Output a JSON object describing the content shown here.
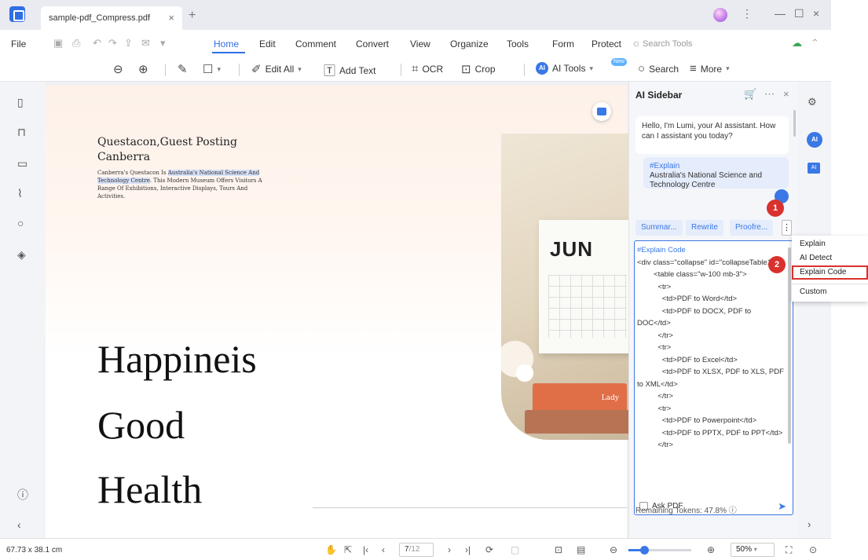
{
  "tab": {
    "title": "sample-pdf_Compress.pdf",
    "close": "×",
    "add": "+"
  },
  "window": {
    "menu_dots": "⋮",
    "minimize": "—",
    "maximize": "☐",
    "close": "×"
  },
  "menu": {
    "file": "File",
    "items": [
      "Home",
      "Edit",
      "Comment",
      "Convert",
      "View",
      "Organize",
      "Tools",
      "Form",
      "Protect"
    ],
    "active": "Home",
    "search_tools": "Search Tools"
  },
  "toolbar": {
    "edit_all": "Edit All",
    "add_text": "Add Text",
    "ocr": "OCR",
    "crop": "Crop",
    "ai_tools": "AI Tools",
    "ai_badge": "AI",
    "new_badge": "New",
    "search": "Search",
    "more": "More"
  },
  "document": {
    "heading": "Questacon,Guest Posting",
    "heading2": "Canberra",
    "body_pre": "Canberra's Questacon Is ",
    "body_hl": "Australia's National Science And Technology Centre",
    "body_post": ". This Modern Museum Offers Visitors A Range Of Exhibitions, Interactive Displays, Tours And Activities.",
    "big_words": [
      "Happineis",
      "Good",
      "Health"
    ],
    "calendar_month": "JUN",
    "book_label": "Lady"
  },
  "sidebar": {
    "title": "AI Sidebar",
    "greeting": "Hello, I'm Lumi, your AI assistant. How can I assistant you today?",
    "user_tag": "#Explain",
    "user_text": "Australia's National Science and Technology Centre",
    "chips": [
      "Summar...",
      "Rewrite",
      "Proofre..."
    ],
    "more": "⋮",
    "code_tag": "#Explain Code",
    "code_body": "<div class=\"collapse\" id=\"collapseTable1\">\n        <table class=\"w-100 mb-3\">\n          <tr>\n            <td>PDF to Word</td>\n            <td>PDF to DOCX, PDF to DOC</td>\n          </tr>\n          <tr>\n            <td>PDF to Excel</td>\n            <td>PDF to XLSX, PDF to XLS, PDF to XML</td>\n          </tr>\n          <tr>\n            <td>PDF to Powerpoint</td>\n            <td>PDF to PPTX, PDF to PPT</td>\n          </tr>",
    "ask_pdf": "Ask PDF",
    "remaining_tokens": "Remaining Tokens: 47.8%"
  },
  "rightbar": {
    "ai_label": "AI",
    "ai2_label": "AI"
  },
  "dropdown": {
    "items": [
      "Explain",
      "AI Detect",
      "Explain Code",
      "Custom"
    ],
    "selected": "Explain Code"
  },
  "steps": [
    "1",
    "2"
  ],
  "status": {
    "dimensions": "67.73 x 38.1 cm",
    "page_current": "7",
    "page_total": "/12",
    "zoom": "50%",
    "zoom_level": 0.25
  },
  "colors": {
    "accent": "#2f6fe4",
    "highlight": "#d9312e"
  }
}
